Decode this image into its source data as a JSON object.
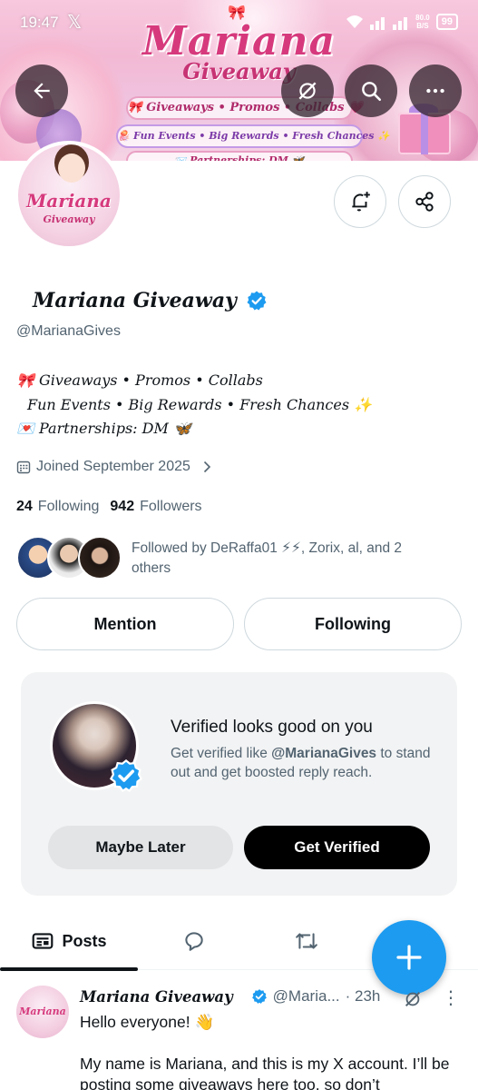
{
  "status_bar": {
    "time": "19:47",
    "x_glyph": "𝕏",
    "net_speed": "80.0",
    "net_unit": "B/S",
    "battery": "99"
  },
  "banner": {
    "title": "Mariana",
    "subtitle": "Giveaway",
    "line1": "🎀 Giveaways • Promos • Collabs 💗",
    "line2": "🪼 Fun Events • Big Rewards • Fresh Chances ✨",
    "line3": "📨 Partnerships: DM 🦋"
  },
  "profile": {
    "avatar_title": "Mariana",
    "avatar_sub": "Giveaway",
    "display_name": "Mariana Giveaway",
    "handle": "@MarianaGives",
    "bio": [
      "🎀 Giveaways • Promos • Collabs",
      "Fun Events • Big Rewards • Fresh Chances ✨",
      "💌 Partnerships: DM  🦋"
    ],
    "joined": "Joined September 2025",
    "following_count": "24",
    "following_label": "Following",
    "followers_count": "942",
    "followers_label": "Followers",
    "followed_by": "Followed by DeRaffa01 ⚡⚡, Zorix, al, and 2 others",
    "mention_label": "Mention",
    "following_button_label": "Following"
  },
  "verified_card": {
    "title": "Verified looks good on you",
    "desc_prefix": "Get verified like ",
    "desc_handle": "@MarianaGives",
    "desc_suffix": " to stand out and get boosted reply reach.",
    "maybe_label": "Maybe Later",
    "get_label": "Get Verified"
  },
  "tabs": {
    "posts_label": "Posts"
  },
  "post": {
    "avatar_text": "Mariana",
    "name": "Mariana Giveaway",
    "handle": "@Maria...",
    "time": "· 23h",
    "line1": "Hello everyone! 👋",
    "line2": "My name is Mariana, and this is my X account. I’ll be posting some giveaways here too, so don’t"
  },
  "colors": {
    "accent": "#1d9bf0",
    "text": "#0f1419",
    "muted": "#536471",
    "border": "#cfd9de",
    "brand_pink": "#d63a7d"
  }
}
